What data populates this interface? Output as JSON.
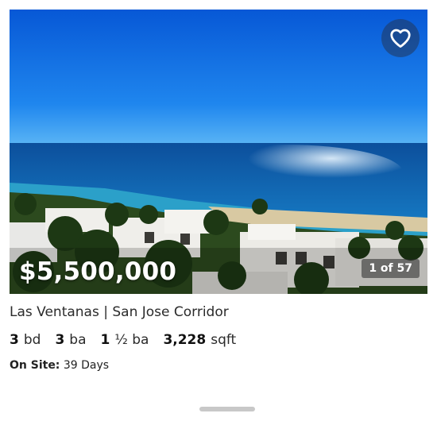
{
  "listing": {
    "price": "$5,500,000",
    "photo_index": "1 of 57",
    "location": "Las Ventanas | San Jose Corridor",
    "specs": [
      {
        "value": "3",
        "unit": "bd"
      },
      {
        "value": "3",
        "unit": "ba"
      },
      {
        "value": "1",
        "unit": "½ ba"
      },
      {
        "value": "3,228",
        "unit": "sqft"
      }
    ],
    "on_site_label": "On Site:",
    "on_site_value": "39 Days"
  },
  "icons": {
    "favorite": "heart-outline-icon"
  },
  "colors": {
    "sky_top": "#0a64d8",
    "sea": "#0e6ab8",
    "fav_button_bg": "#23375a",
    "text": "#1f1f1f"
  }
}
